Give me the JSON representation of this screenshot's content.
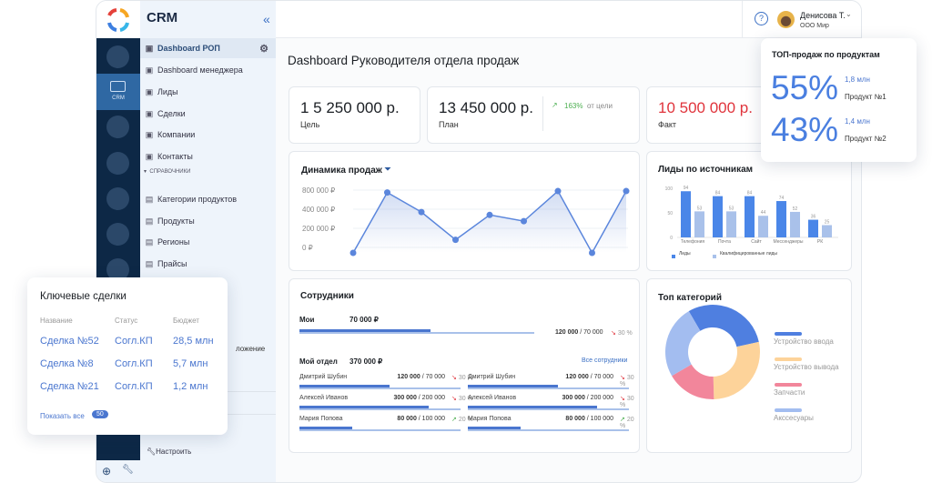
{
  "header": {
    "app": "CRM",
    "collapse_icon": "chevrons-left-icon",
    "help_icon": "question-icon",
    "user_name": "Денисова Т.",
    "user_org": "ООО Мир"
  },
  "rail": {
    "active_label": "CRM"
  },
  "nav": {
    "items": [
      {
        "label": "Dashboard РОП",
        "icon": "trophy-icon",
        "active": true
      },
      {
        "label": "Dashboard менеджера",
        "icon": "trophy-icon"
      },
      {
        "label": "Лиды",
        "icon": "search-people-icon"
      },
      {
        "label": "Сделки",
        "icon": "stack-icon"
      },
      {
        "label": "Компании",
        "icon": "building-icon"
      },
      {
        "label": "Контакты",
        "icon": "people-icon"
      }
    ],
    "section": "СПРАВОЧНИКИ",
    "ref_items": [
      {
        "label": "Категории продуктов",
        "icon": "folder-icon"
      },
      {
        "label": "Продукты",
        "icon": "grid-icon"
      },
      {
        "label": "Регионы",
        "icon": "list-icon"
      },
      {
        "label": "Прайсы",
        "icon": "book-icon"
      }
    ],
    "partial_item": "ложение",
    "settings": "Настроить"
  },
  "page": {
    "title": "Dashboard Руководителя отдела продаж"
  },
  "kpi": {
    "goal": {
      "value": "1 5 250 000 р.",
      "label": "Цель"
    },
    "plan": {
      "value": "13 450 000 р.",
      "label": "План",
      "delta": "163%",
      "delta_text": "от цели"
    },
    "fact": {
      "value": "10 500 000 р.",
      "label": "Факт"
    }
  },
  "colors": {
    "accent": "#4a76cf",
    "light": "#a9c1ea",
    "red": "#e0343c",
    "green": "#4caf50"
  },
  "chart_data": [
    {
      "type": "line",
      "title": "Динамика продаж",
      "ytick_labels": [
        "800 000 ₽",
        "400 000 ₽",
        "200 000 ₽",
        "0 ₽"
      ],
      "yticks": [
        800000,
        400000,
        200000,
        0
      ],
      "values": [
        0,
        750000,
        370000,
        80000,
        340000,
        275000,
        780000,
        0,
        780000
      ],
      "grid": true
    },
    {
      "type": "bar",
      "title": "Лиды по источникам",
      "categories": [
        "Телефония",
        "Почта",
        "Сайт",
        "Мессенджеры",
        "РК"
      ],
      "yticks": [
        0,
        50,
        100
      ],
      "ylim": [
        0,
        100
      ],
      "legend": "bottom",
      "series": [
        {
          "name": "Лиды",
          "values": [
            94,
            84,
            84,
            74,
            36
          ],
          "color": "#4a86e8"
        },
        {
          "name": "Квалифицированные лиды",
          "values": [
            53,
            53,
            44,
            52,
            25
          ],
          "color": "#a9c1ea"
        }
      ]
    },
    {
      "type": "pie",
      "title": "Топ категорий",
      "legend": "right",
      "labels": [
        "Устройство ввода",
        "Устройство вывода",
        "Запчасти",
        "Акссесуары"
      ],
      "values": [
        30,
        28,
        17,
        25
      ],
      "colors": [
        "#4f7fe0",
        "#fdd39a",
        "#f2869b",
        "#a3bdf0"
      ]
    }
  ],
  "employees": {
    "title": "Сотрудники",
    "mine_label": "Мои",
    "mine_value": "70 000 ₽",
    "mine_ratio": "120 000",
    "mine_target": "/ 70 000",
    "mine_delta": "30 %",
    "mine_progress": 0.56,
    "dept_label": "Мой отдел",
    "dept_value": "370 000 ₽",
    "all_link": "Все сотрудники",
    "rows": [
      {
        "name": "Дмитрий Шубин",
        "amount": "120 000",
        "target": "/ 70 000",
        "delta": "30 %",
        "dir": "down",
        "progress": 0.56
      },
      {
        "name": "Алексей Иванов",
        "amount": "300 000",
        "target": "/ 200 000",
        "delta": "30 %",
        "dir": "down",
        "progress": 0.8
      },
      {
        "name": "Мария Попова",
        "amount": "80 000",
        "target": "/ 100 000",
        "delta": "20 %",
        "dir": "up",
        "progress": 0.33
      }
    ]
  },
  "top_products": {
    "title": "ТОП-продаж по продуктам",
    "items": [
      {
        "pct": "55%",
        "amount": "1,8 млн",
        "name": "Продукт №1"
      },
      {
        "pct": "43%",
        "amount": "1,4 млн",
        "name": "Продукт №2"
      }
    ]
  },
  "deals": {
    "title": "Ключевые сделки",
    "headers": [
      "Название",
      "Статус",
      "Бюджет"
    ],
    "rows": [
      [
        "Сделка №52",
        "Согл.КП",
        "28,5 млн"
      ],
      [
        "Сделка №8",
        "Согл.КП",
        "5,7 млн"
      ],
      [
        "Сделка №21",
        "Согл.КП",
        "1,2 млн"
      ]
    ],
    "show_all": "Показать все",
    "count": "50"
  }
}
